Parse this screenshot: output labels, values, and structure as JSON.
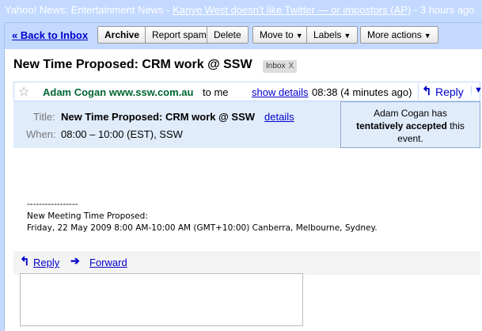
{
  "news_bar": {
    "prefix": "Yahoo! News: Entertainment News - ",
    "link": "Kanye West doesn't like Twitter — or impostors (AP)",
    "suffix": " - 3 hours ago"
  },
  "toolbar": {
    "back": "« Back to Inbox",
    "archive": "Archive",
    "report_spam": "Report spam",
    "delete": "Delete",
    "move_to": "Move to",
    "labels": "Labels",
    "more_actions": "More actions"
  },
  "email": {
    "subject": "New Time Proposed: CRM work @ SSW",
    "label": "Inbox",
    "label_remove": "X",
    "sender": "Adam Cogan www.ssw.com.au",
    "to": "to me",
    "show_details": "show details",
    "time": "08:38 (4 minutes ago)",
    "reply": "Reply"
  },
  "invite": {
    "title_label": "Title:",
    "title": "New Time Proposed: CRM work @ SSW",
    "details": "details",
    "when_label": "When:",
    "when": "08:00 – 10:00 (EST), SSW",
    "status_pre": "Adam Cogan has",
    "status_bold": "tentatively accepted",
    "status_post1": "this",
    "status_post2": "event."
  },
  "body": {
    "line1": "-----------------",
    "line2": "New Meeting Time Proposed:",
    "line3": "Friday, 22 May 2009 8:00 AM-10:00 AM (GMT+10:00) Canberra, Melbourne, Sydney."
  },
  "actions": {
    "reply": "Reply",
    "forward": "Forward"
  },
  "colors": {
    "toolbar_bg": "#c3d9ff",
    "invite_bg": "#e1ecfb",
    "link": "#0000cc",
    "sender": "#006633"
  }
}
